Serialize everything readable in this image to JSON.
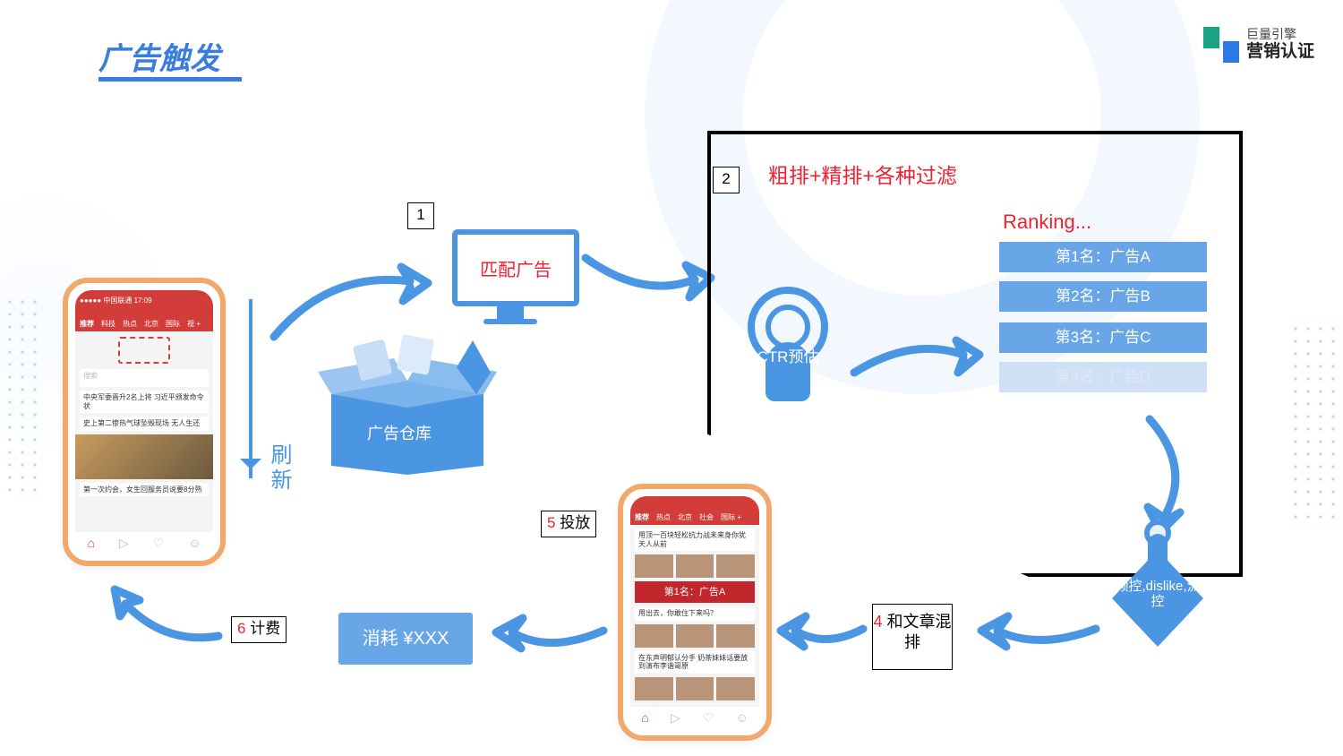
{
  "title": "广告触发",
  "logo": {
    "line1": "巨量引擎",
    "line2": "营销认证"
  },
  "refresh_label": "刷新",
  "steps": {
    "s1": {
      "num": "1",
      "label": "匹配广告"
    },
    "s2": {
      "num": "2",
      "label": "粗排+精排+各种过滤"
    },
    "s4": {
      "num": "4",
      "label": "和文章混排"
    },
    "s5": {
      "num": "5",
      "label": "投放"
    },
    "s6": {
      "num": "6",
      "label": "计费"
    }
  },
  "warehouse_label": "广告仓库",
  "ctr_label": "CTR预估",
  "filter_label": "频控,dislike,流控",
  "ranking": {
    "title": "Ranking...",
    "items": [
      "第1名：广告A",
      "第2名：广告B",
      "第3名：广告C",
      "第4名：广告D"
    ]
  },
  "consume_label": "消耗 ¥XXX",
  "phone1": {
    "status": "●●●●● 中国联通 17:09",
    "tabs": [
      "推荐",
      "科技",
      "热点",
      "北京",
      "国际",
      "视 +"
    ],
    "search": "搜索",
    "story1": "中央军委晋升2名上将 习近平颁发命令状",
    "story2": "史上第二惨热气球坠毁现场 无人生还",
    "story3": "第一次约会，女生回服务员说要8分熟"
  },
  "phone2": {
    "tabs": [
      "推荐",
      "热点",
      "北京",
      "社会",
      "国际 +"
    ],
    "banner": "第1名：广告A",
    "story_a": "用顶一百块轻松抗力战未来身你犹天人从前",
    "story_b": "用出去，你敢住下来吗？",
    "story_c": "在东声明郁认分手 奶茶妹妹话要放到演布李谐哥原"
  }
}
